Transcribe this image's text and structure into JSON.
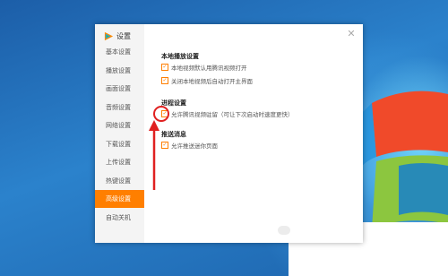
{
  "dialog": {
    "title": "设置",
    "close_glyph": "✕"
  },
  "sidebar": {
    "items": [
      {
        "label": "基本设置"
      },
      {
        "label": "播放设置"
      },
      {
        "label": "画面设置"
      },
      {
        "label": "音频设置"
      },
      {
        "label": "网络设置"
      },
      {
        "label": "下载设置"
      },
      {
        "label": "上传设置"
      },
      {
        "label": "热键设置"
      },
      {
        "label": "高级设置"
      },
      {
        "label": "自动关机"
      }
    ],
    "active_index": 8
  },
  "sections": [
    {
      "title": "本地播放设置",
      "options": [
        {
          "label": "本地视频默认用腾讯视频打开",
          "checked": true
        },
        {
          "label": "关闭本地视频后自动打开主界面",
          "checked": true
        }
      ]
    },
    {
      "title": "进程设置",
      "options": [
        {
          "label": "允许腾讯视频驻留（可让下次启动时速度更快）",
          "checked": true
        }
      ]
    },
    {
      "title": "推送消息",
      "options": [
        {
          "label": "允许推送迷你页面",
          "checked": true
        }
      ]
    }
  ],
  "colors": {
    "accent": "#ff7f00",
    "annotation": "#e02020"
  },
  "icons": {
    "logo": "tencent-video-logo-icon",
    "close": "close-icon",
    "check": "checkmark-icon"
  }
}
